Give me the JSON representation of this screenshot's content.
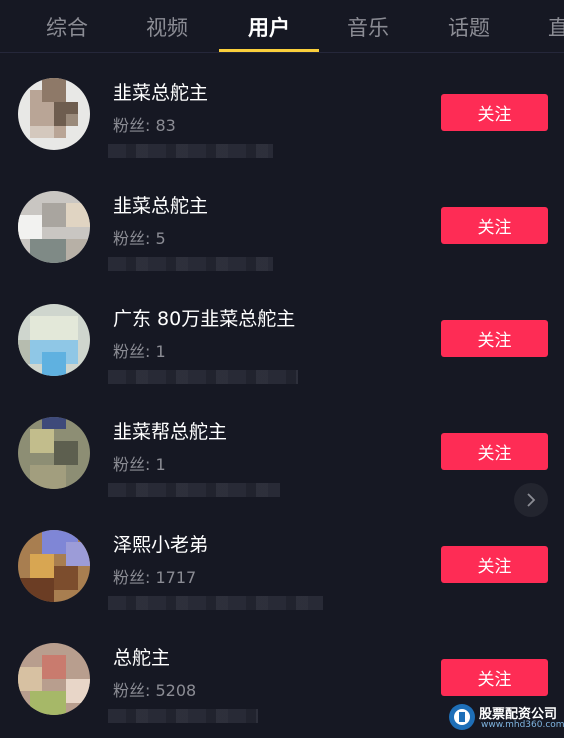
{
  "tabs": [
    {
      "label": "综合",
      "active": false
    },
    {
      "label": "视频",
      "active": false
    },
    {
      "label": "用户",
      "active": true
    },
    {
      "label": "音乐",
      "active": false
    },
    {
      "label": "话题",
      "active": false
    },
    {
      "label": "直",
      "active": false
    }
  ],
  "users": [
    {
      "name": "韭菜总舵主",
      "fans": "粉丝: 83",
      "follow_label": "关注"
    },
    {
      "name": "韭菜总舵主",
      "fans": "粉丝: 5",
      "follow_label": "关注"
    },
    {
      "name": "广东 80万韭菜总舵主",
      "fans": "粉丝: 1",
      "follow_label": "关注"
    },
    {
      "name": "韭菜帮总舵主",
      "fans": "粉丝: 1",
      "follow_label": "关注"
    },
    {
      "name": "泽熙小老弟",
      "fans": "粉丝: 1717",
      "follow_label": "关注"
    },
    {
      "name": "总舵主",
      "fans": "粉丝: 5208",
      "follow_label": "关注"
    }
  ],
  "watermark": {
    "title": "股票配资公司",
    "url": "www.mhd360.com"
  },
  "colors": {
    "background": "#161823",
    "follow_button": "#fe2c55",
    "tab_indicator": "#facf3c",
    "muted_text": "#8b8c94"
  },
  "icons": {
    "more": "chevron-right-icon"
  }
}
